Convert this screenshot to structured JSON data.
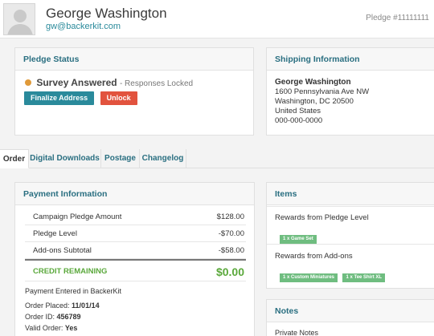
{
  "header": {
    "name": "George Washington",
    "email": "gw@backerkit.com",
    "pledge_id": "Pledge #11111111"
  },
  "pledge_status": {
    "title": "Pledge Status",
    "status": "Survey Answered",
    "status_sub": "- Responses Locked",
    "status_color": "#e09a3a",
    "finalize_label": "Finalize Address",
    "unlock_label": "Unlock"
  },
  "shipping": {
    "title": "Shipping Information",
    "name": "George Washington",
    "street": "1600 Pennsylvania Ave NW",
    "city": "Washington, DC 20500",
    "country": "United States",
    "phone": "000-000-0000"
  },
  "tabs": [
    "Order",
    "Digital Downloads",
    "Postage",
    "Changelog"
  ],
  "payment": {
    "title": "Payment Information",
    "rows": [
      {
        "label": "Campaign Pledge Amount",
        "value": "$128.00"
      },
      {
        "label": "Pledge Level",
        "value": "-$70.00"
      },
      {
        "label": "Add-ons Subtotal",
        "value": "-$58.00"
      }
    ],
    "credit_label": "CREDIT REMAINING",
    "credit_value": "$0.00",
    "entered": "Payment Entered in BackerKit",
    "order_placed_label": "Order Placed:",
    "order_placed_value": "11/01/14",
    "order_id_label": "Order ID:",
    "order_id_value": "456789",
    "valid_label": "Valid Order:",
    "valid_value": "Yes"
  },
  "items": {
    "title": "Items",
    "pledge_rewards_label": "Rewards from Pledge Level",
    "pledge_rewards": [
      "1 x Game Set"
    ],
    "addon_rewards_label": "Rewards from Add-ons",
    "addon_rewards": [
      "1 x Custom Miniatures",
      "1 x Tee Shirt XL"
    ]
  },
  "notes": {
    "title": "Notes",
    "private_label": "Private Notes"
  },
  "colors": {
    "accent": "#2a8a9b",
    "danger": "#e2533e",
    "success": "#5aa83b",
    "tag": "#6fbd80"
  }
}
